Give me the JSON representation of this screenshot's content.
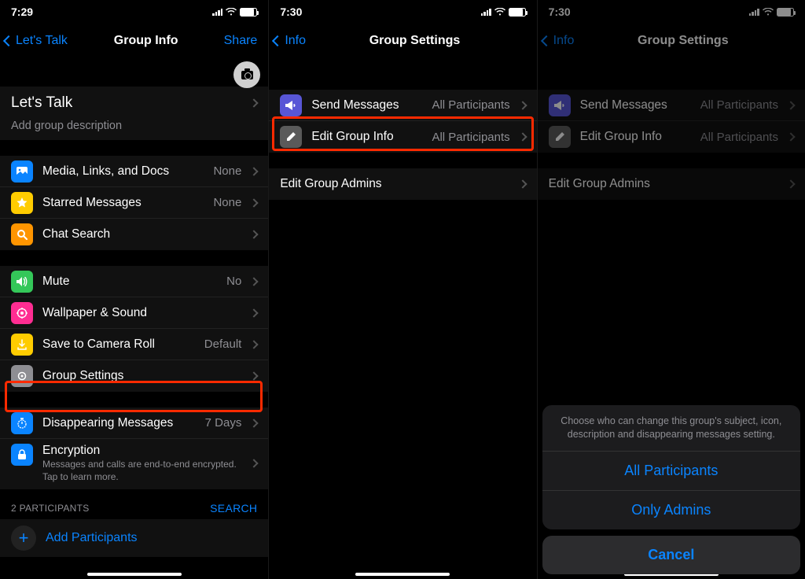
{
  "panel1": {
    "time": "7:29",
    "back": "Let's Talk",
    "title": "Group Info",
    "share": "Share",
    "groupName": "Let's Talk",
    "addDesc": "Add group description",
    "rows": {
      "media": {
        "label": "Media, Links, and Docs",
        "value": "None"
      },
      "starred": {
        "label": "Starred Messages",
        "value": "None"
      },
      "search": {
        "label": "Chat Search",
        "value": ""
      },
      "mute": {
        "label": "Mute",
        "value": "No"
      },
      "wallpaper": {
        "label": "Wallpaper & Sound",
        "value": ""
      },
      "save": {
        "label": "Save to Camera Roll",
        "value": "Default"
      },
      "groupSettings": {
        "label": "Group Settings",
        "value": ""
      },
      "disappearing": {
        "label": "Disappearing Messages",
        "value": "7 Days"
      },
      "encTitle": "Encryption",
      "encSub": "Messages and calls are end-to-end encrypted. Tap to learn more."
    },
    "participantsHeader": "2 PARTICIPANTS",
    "searchLabel": "SEARCH",
    "addParticipants": "Add Participants"
  },
  "panel2": {
    "time": "7:30",
    "back": "Info",
    "title": "Group Settings",
    "rows": {
      "send": {
        "label": "Send Messages",
        "value": "All Participants"
      },
      "edit": {
        "label": "Edit Group Info",
        "value": "All Participants"
      },
      "admins": {
        "label": "Edit Group Admins",
        "value": ""
      }
    }
  },
  "panel3": {
    "time": "7:30",
    "back": "Info",
    "title": "Group Settings",
    "rows": {
      "send": {
        "label": "Send Messages",
        "value": "All Participants"
      },
      "edit": {
        "label": "Edit Group Info",
        "value": "All Participants"
      },
      "admins": {
        "label": "Edit Group Admins",
        "value": ""
      }
    },
    "sheet": {
      "desc": "Choose who can change this group's subject, icon, description and disappearing messages setting.",
      "opt1": "All Participants",
      "opt2": "Only Admins",
      "cancel": "Cancel"
    }
  }
}
